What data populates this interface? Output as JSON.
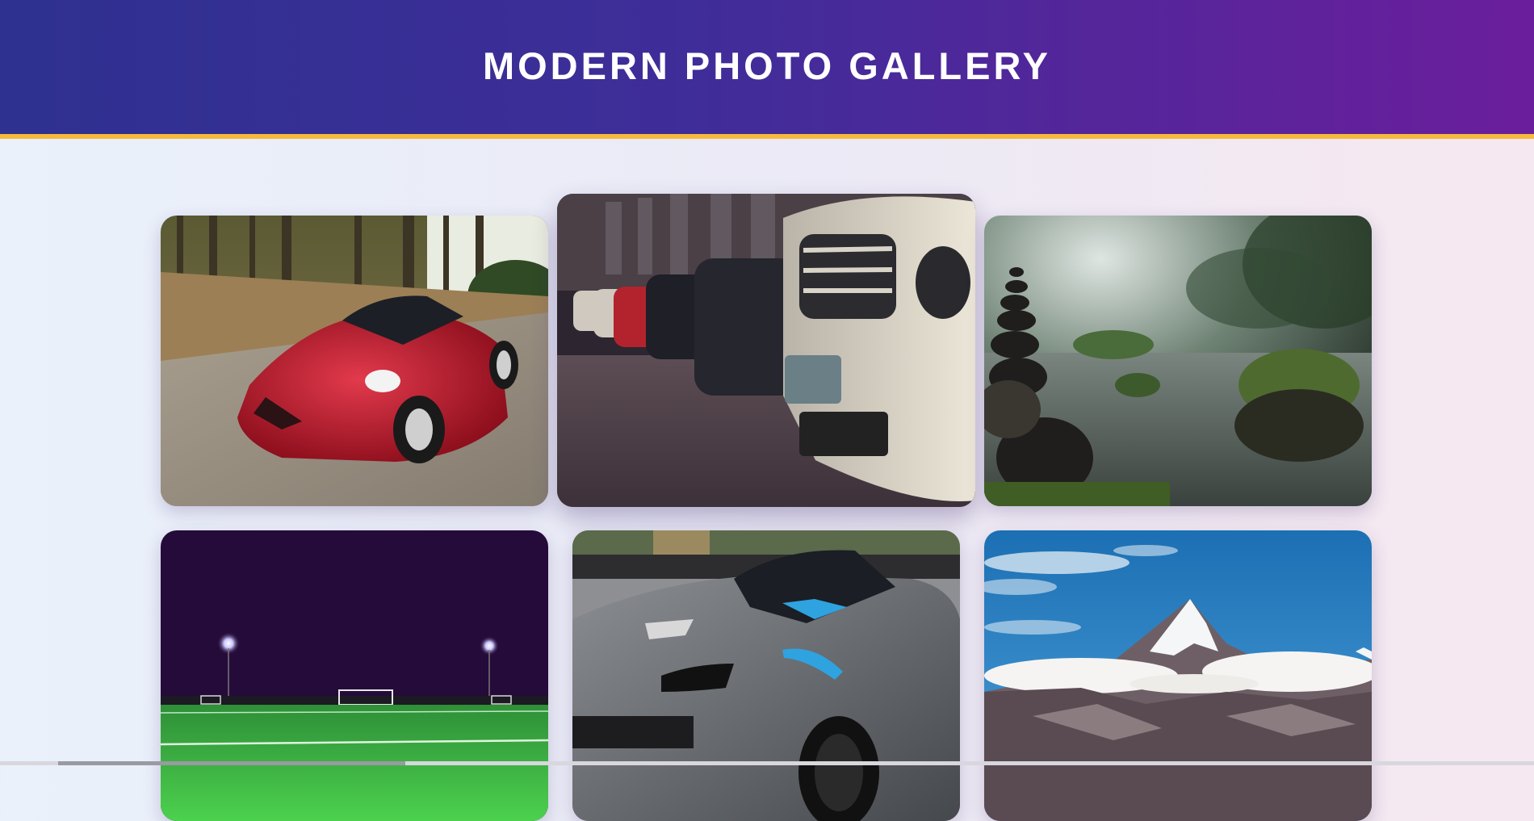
{
  "header": {
    "title": "MODERN PHOTO GALLERY"
  },
  "colors": {
    "header_start": "#2e3190",
    "header_end": "#6b1e9c",
    "header_border": "#f6b93b"
  },
  "gallery": {
    "photos": [
      {
        "subject": "red sports car driving on forest road",
        "state": "normal"
      },
      {
        "subject": "row of parked luxury cars at dealership",
        "state": "hovered"
      },
      {
        "subject": "stacked stones beside misty forest river",
        "state": "normal"
      },
      {
        "subject": "football pitch at night under floodlights",
        "state": "normal"
      },
      {
        "subject": "grey sports car with blue stripe at auto show",
        "state": "normal"
      },
      {
        "subject": "snowy mountain peak above clouds",
        "state": "normal"
      }
    ]
  }
}
